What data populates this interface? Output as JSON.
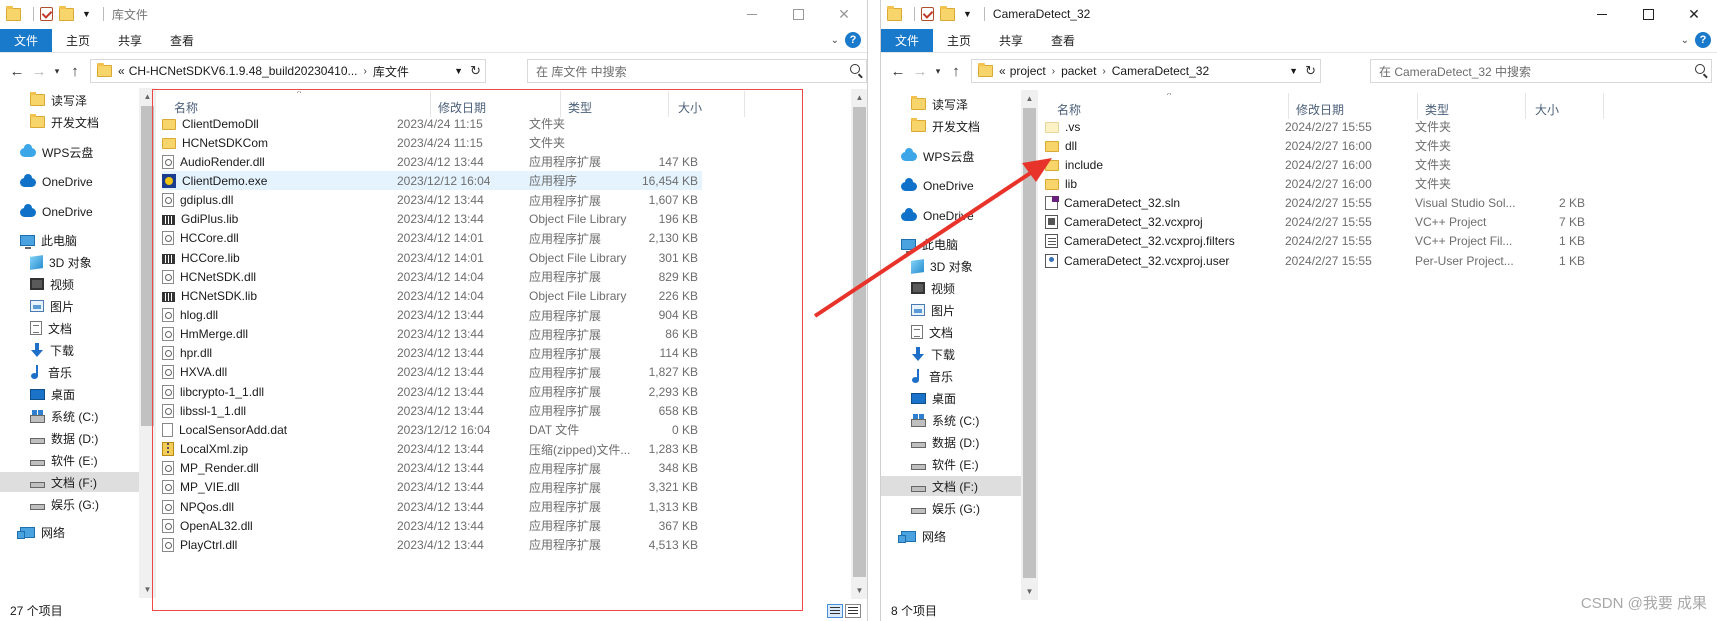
{
  "left": {
    "title": "库文件",
    "tabs": {
      "file": "文件",
      "home": "主页",
      "share": "共享",
      "view": "查看"
    },
    "address": {
      "prefix": "«",
      "crumbs": [
        "CH-HCNetSDKV6.1.9.48_build20230410...",
        "库文件"
      ]
    },
    "search_placeholder": "在 库文件 中搜索",
    "nav": [
      "读写泽",
      "开发文档",
      "WPS云盘",
      "OneDrive",
      "OneDrive",
      "此电脑",
      "3D 对象",
      "视频",
      "图片",
      "文档",
      "下载",
      "音乐",
      "桌面",
      "系统 (C:)",
      "数据 (D:)",
      "软件 (E:)",
      "文档 (F:)",
      "娱乐 (G:)",
      "网络"
    ],
    "columns": {
      "name": "名称",
      "date": "修改日期",
      "type": "类型",
      "size": "大小"
    },
    "files": [
      {
        "name": "ClientDemoDll",
        "date": "2023/4/24 11:15",
        "type": "文件夹",
        "size": "",
        "icon": "folder"
      },
      {
        "name": "HCNetSDKCom",
        "date": "2023/4/24 11:15",
        "type": "文件夹",
        "size": "",
        "icon": "folder"
      },
      {
        "name": "AudioRender.dll",
        "date": "2023/4/12 13:44",
        "type": "应用程序扩展",
        "size": "147 KB",
        "icon": "dll"
      },
      {
        "name": "ClientDemo.exe",
        "date": "2023/12/12 16:04",
        "type": "应用程序",
        "size": "16,454 KB",
        "icon": "exe"
      },
      {
        "name": "gdiplus.dll",
        "date": "2023/4/12 13:44",
        "type": "应用程序扩展",
        "size": "1,607 KB",
        "icon": "dll"
      },
      {
        "name": "GdiPlus.lib",
        "date": "2023/4/12 13:44",
        "type": "Object File Library",
        "size": "196 KB",
        "icon": "lib"
      },
      {
        "name": "HCCore.dll",
        "date": "2023/4/12 14:01",
        "type": "应用程序扩展",
        "size": "2,130 KB",
        "icon": "dll"
      },
      {
        "name": "HCCore.lib",
        "date": "2023/4/12 14:01",
        "type": "Object File Library",
        "size": "301 KB",
        "icon": "lib"
      },
      {
        "name": "HCNetSDK.dll",
        "date": "2023/4/12 14:04",
        "type": "应用程序扩展",
        "size": "829 KB",
        "icon": "dll"
      },
      {
        "name": "HCNetSDK.lib",
        "date": "2023/4/12 14:04",
        "type": "Object File Library",
        "size": "226 KB",
        "icon": "lib"
      },
      {
        "name": "hlog.dll",
        "date": "2023/4/12 13:44",
        "type": "应用程序扩展",
        "size": "904 KB",
        "icon": "dll"
      },
      {
        "name": "HmMerge.dll",
        "date": "2023/4/12 13:44",
        "type": "应用程序扩展",
        "size": "86 KB",
        "icon": "dll"
      },
      {
        "name": "hpr.dll",
        "date": "2023/4/12 13:44",
        "type": "应用程序扩展",
        "size": "114 KB",
        "icon": "dll"
      },
      {
        "name": "HXVA.dll",
        "date": "2023/4/12 13:44",
        "type": "应用程序扩展",
        "size": "1,827 KB",
        "icon": "dll"
      },
      {
        "name": "libcrypto-1_1.dll",
        "date": "2023/4/12 13:44",
        "type": "应用程序扩展",
        "size": "2,293 KB",
        "icon": "dll"
      },
      {
        "name": "libssl-1_1.dll",
        "date": "2023/4/12 13:44",
        "type": "应用程序扩展",
        "size": "658 KB",
        "icon": "dll"
      },
      {
        "name": "LocalSensorAdd.dat",
        "date": "2023/12/12 16:04",
        "type": "DAT 文件",
        "size": "0 KB",
        "icon": "dat"
      },
      {
        "name": "LocalXml.zip",
        "date": "2023/4/12 13:44",
        "type": "压缩(zipped)文件...",
        "size": "1,283 KB",
        "icon": "zip"
      },
      {
        "name": "MP_Render.dll",
        "date": "2023/4/12 13:44",
        "type": "应用程序扩展",
        "size": "348 KB",
        "icon": "dll"
      },
      {
        "name": "MP_VIE.dll",
        "date": "2023/4/12 13:44",
        "type": "应用程序扩展",
        "size": "3,321 KB",
        "icon": "dll"
      },
      {
        "name": "NPQos.dll",
        "date": "2023/4/12 13:44",
        "type": "应用程序扩展",
        "size": "1,313 KB",
        "icon": "dll"
      },
      {
        "name": "OpenAL32.dll",
        "date": "2023/4/12 13:44",
        "type": "应用程序扩展",
        "size": "367 KB",
        "icon": "dll"
      },
      {
        "name": "PlayCtrl.dll",
        "date": "2023/4/12 13:44",
        "type": "应用程序扩展",
        "size": "4,513 KB",
        "icon": "dll"
      }
    ],
    "status": "27 个项目"
  },
  "right": {
    "title": "CameraDetect_32",
    "tabs": {
      "file": "文件",
      "home": "主页",
      "share": "共享",
      "view": "查看"
    },
    "address": {
      "prefix": "«",
      "crumbs": [
        "project",
        "packet",
        "CameraDetect_32"
      ]
    },
    "search_placeholder": "在 CameraDetect_32 中搜索",
    "nav": [
      "读写泽",
      "开发文档",
      "WPS云盘",
      "OneDrive",
      "OneDrive",
      "此电脑",
      "3D 对象",
      "视频",
      "图片",
      "文档",
      "下载",
      "音乐",
      "桌面",
      "系统 (C:)",
      "数据 (D:)",
      "软件 (E:)",
      "文档 (F:)",
      "娱乐 (G:)",
      "网络"
    ],
    "columns": {
      "name": "名称",
      "date": "修改日期",
      "type": "类型",
      "size": "大小"
    },
    "files": [
      {
        "name": ".vs",
        "date": "2024/2/27 15:55",
        "type": "文件夹",
        "size": "",
        "icon": "folder-light"
      },
      {
        "name": "dll",
        "date": "2024/2/27 16:00",
        "type": "文件夹",
        "size": "",
        "icon": "folder"
      },
      {
        "name": "include",
        "date": "2024/2/27 16:00",
        "type": "文件夹",
        "size": "",
        "icon": "folder"
      },
      {
        "name": "lib",
        "date": "2024/2/27 16:00",
        "type": "文件夹",
        "size": "",
        "icon": "folder"
      },
      {
        "name": "CameraDetect_32.sln",
        "date": "2024/2/27 15:55",
        "type": "Visual Studio Sol...",
        "size": "2 KB",
        "icon": "sln"
      },
      {
        "name": "CameraDetect_32.vcxproj",
        "date": "2024/2/27 15:55",
        "type": "VC++ Project",
        "size": "7 KB",
        "icon": "proj"
      },
      {
        "name": "CameraDetect_32.vcxproj.filters",
        "date": "2024/2/27 15:55",
        "type": "VC++ Project Fil...",
        "size": "1 KB",
        "icon": "filt"
      },
      {
        "name": "CameraDetect_32.vcxproj.user",
        "date": "2024/2/27 15:55",
        "type": "Per-User Project...",
        "size": "1 KB",
        "icon": "user"
      }
    ],
    "status": "8 个项目"
  },
  "watermark": "CSDN @我要 成果",
  "colors": {
    "accent": "#1979ca",
    "highlight_box": "#ec4b45",
    "arrow": "#e8332a",
    "row_hover": "#e5f3ff"
  }
}
